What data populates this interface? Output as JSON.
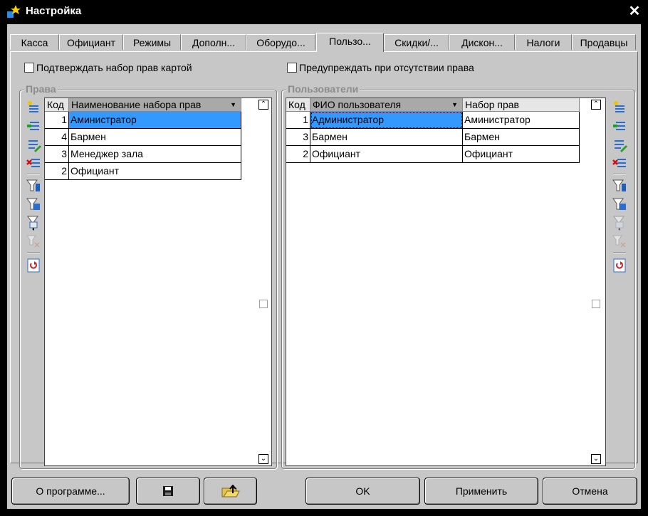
{
  "window": {
    "title": "Настройка",
    "close_glyph": "✕"
  },
  "tabs": [
    {
      "label": "Касса"
    },
    {
      "label": "Официант"
    },
    {
      "label": "Режимы"
    },
    {
      "label": "Дополн..."
    },
    {
      "label": "Оборудо..."
    },
    {
      "label": "Пользо...",
      "active": true
    },
    {
      "label": "Скидки/..."
    },
    {
      "label": "Дискон..."
    },
    {
      "label": "Налоги"
    },
    {
      "label": "Продавцы"
    }
  ],
  "options": {
    "confirm_rights_by_card": {
      "label": "Подтверждать набор прав картой",
      "checked": false
    },
    "warn_missing_right": {
      "label": "Предупреждать при отсутствии права",
      "checked": false
    }
  },
  "rights": {
    "title": "Права",
    "columns": {
      "code": "Код",
      "name": "Наименование набора прав"
    },
    "rows": [
      {
        "code": "1",
        "name": "Аминистратор"
      },
      {
        "code": "4",
        "name": "Бармен"
      },
      {
        "code": "3",
        "name": "Менеджер зала"
      },
      {
        "code": "2",
        "name": "Официант"
      }
    ],
    "selected_row": 0
  },
  "users": {
    "title": "Пользователи",
    "columns": {
      "code": "Код",
      "name": "ФИО пользователя",
      "rights": "Набор прав"
    },
    "rows": [
      {
        "code": "1",
        "name": "Администратор",
        "rights": "Аминистратор"
      },
      {
        "code": "3",
        "name": "Бармен",
        "rights": "Бармен"
      },
      {
        "code": "2",
        "name": "Официант",
        "rights": "Официант"
      }
    ],
    "selected_row": 0
  },
  "toolbar_icons": {
    "add": "add-record-icon",
    "insert": "insert-record-icon",
    "edit": "edit-record-icon",
    "delete": "delete-record-icon",
    "filter": "filter-icon",
    "filter_form": "filter-form-icon",
    "copy_filter": "copy-filter-icon",
    "clear_filter": "clear-filter-icon",
    "refresh": "refresh-icon"
  },
  "buttons": {
    "about": "О программе...",
    "ok": "OK",
    "apply": "Применить",
    "cancel": "Отмена"
  },
  "colors": {
    "selection": "#3399ff",
    "window_bg": "#c7c7c7",
    "titlebar": "#000000",
    "group_title": "#8c8c8c"
  }
}
